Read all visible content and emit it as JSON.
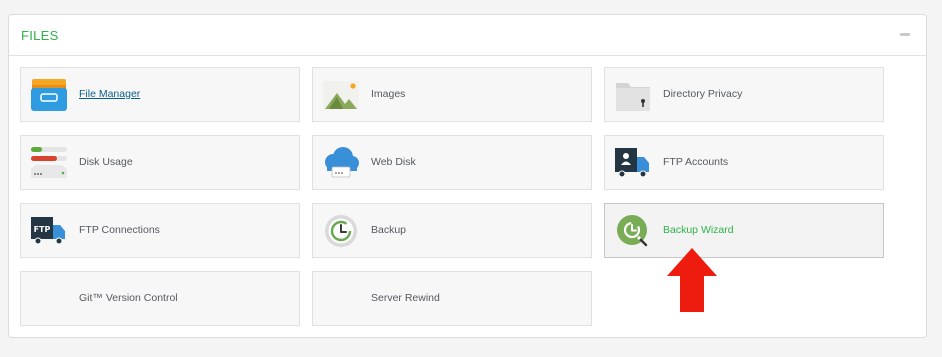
{
  "section": {
    "title": "FILES",
    "collapse_icon": "minus-icon"
  },
  "tiles": [
    {
      "label": "File Manager",
      "icon": "file-cabinet-icon"
    },
    {
      "label": "Images",
      "icon": "image-icon"
    },
    {
      "label": "Directory Privacy",
      "icon": "locked-folder-icon"
    },
    {
      "label": "Disk Usage",
      "icon": "disk-usage-icon"
    },
    {
      "label": "Web Disk",
      "icon": "cloud-drive-icon"
    },
    {
      "label": "FTP Accounts",
      "icon": "ftp-account-truck-icon"
    },
    {
      "label": "FTP Connections",
      "icon": "ftp-truck-icon"
    },
    {
      "label": "Backup",
      "icon": "backup-clock-icon"
    },
    {
      "label": "Backup Wizard",
      "icon": "backup-wizard-icon"
    },
    {
      "label": "Git™ Version Control",
      "icon": ""
    },
    {
      "label": "Server Rewind",
      "icon": ""
    }
  ],
  "ftp_icon_text": "FTP",
  "colors": {
    "accent_green": "#2cb34a",
    "link_blue": "#0b5f8a",
    "annotation_arrow": "#ee1c0f"
  }
}
